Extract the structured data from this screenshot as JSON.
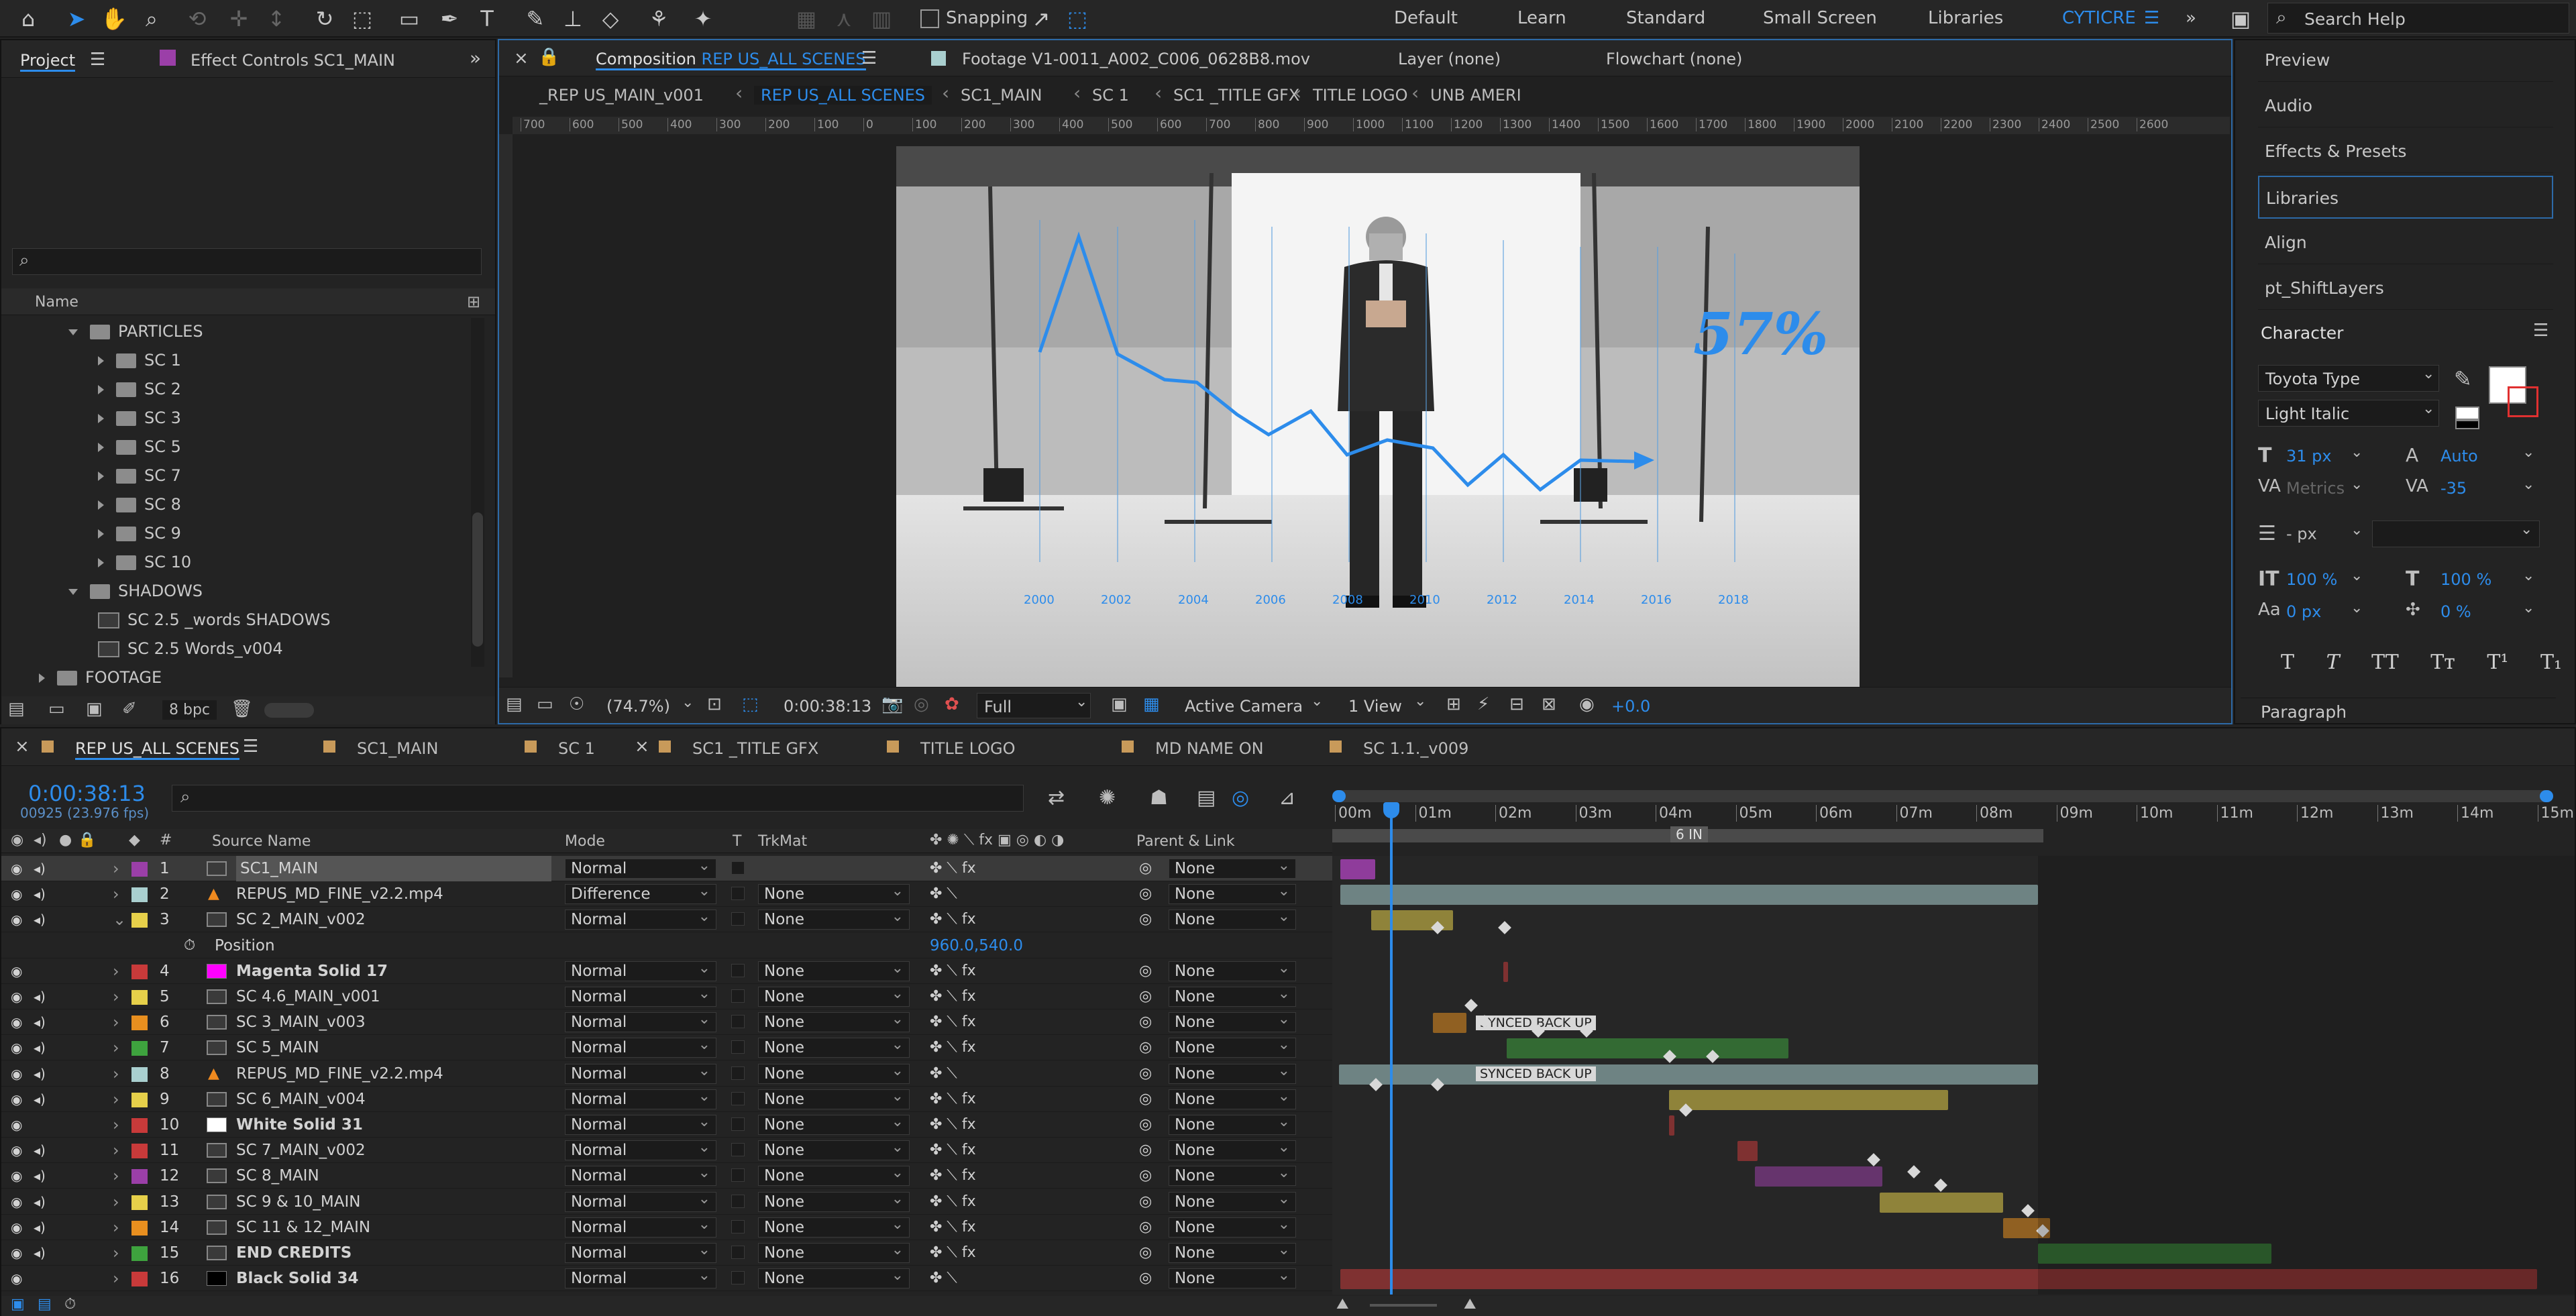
{
  "toolbar": {
    "snapping_label": "Snapping",
    "workspaces": [
      "Default",
      "Learn",
      "Standard",
      "Small Screen",
      "Libraries",
      "CYTICRE"
    ],
    "active_workspace": "CYTICRE",
    "search_placeholder": "Search Help"
  },
  "project_panel": {
    "tab_project": "Project",
    "tab_effect_controls": "Effect Controls SC1_MAIN",
    "column_name": "Name",
    "items": [
      {
        "label": "PARTICLES",
        "kind": "folder-open"
      },
      {
        "label": "SC 1",
        "kind": "folder"
      },
      {
        "label": "SC 2",
        "kind": "folder"
      },
      {
        "label": "SC 3",
        "kind": "folder"
      },
      {
        "label": "SC 5",
        "kind": "folder"
      },
      {
        "label": "SC 7",
        "kind": "folder"
      },
      {
        "label": "SC 8",
        "kind": "folder"
      },
      {
        "label": "SC 9",
        "kind": "folder"
      },
      {
        "label": "SC 10",
        "kind": "folder"
      },
      {
        "label": "SHADOWS",
        "kind": "folder-open"
      },
      {
        "label": "SC 2.5 _words SHADOWS",
        "kind": "comp"
      },
      {
        "label": "SC 2.5 Words_v004",
        "kind": "comp"
      },
      {
        "label": "FOOTAGE",
        "kind": "folder"
      }
    ],
    "bpc": "8 bpc"
  },
  "viewer": {
    "tab_composition": "Composition",
    "composition_name": "REP US_ALL SCENES",
    "tab_footage": "Footage V1-0011_A002_C006_0628B8.mov",
    "tab_layer": "Layer (none)",
    "tab_flowchart": "Flowchart (none)",
    "breadcrumbs": [
      "_REP US_MAIN_v001",
      "REP US_ALL SCENES",
      "SC1_MAIN",
      "SC 1",
      "SC1 _TITLE GFX",
      "TITLE LOGO",
      "UNB AMERI"
    ],
    "ruler_ticks": [
      "700",
      "600",
      "500",
      "400",
      "300",
      "200",
      "100",
      "0",
      "100",
      "200",
      "300",
      "400",
      "500",
      "600",
      "700",
      "800",
      "900",
      "1000",
      "1100",
      "1200",
      "1300",
      "1400",
      "1500",
      "1600",
      "1700",
      "1800",
      "1900",
      "2000",
      "2100",
      "2200",
      "2300",
      "2400",
      "2500",
      "2600"
    ],
    "zoom": "(74.7%)",
    "timecode": "0:00:38:13",
    "resolution": "Full",
    "camera": "Active Camera",
    "view_count": "1 View",
    "exposure": "+0.0",
    "overlay_percent": "57%",
    "overlay_years": [
      "2000",
      "2002",
      "2004",
      "2006",
      "2008",
      "2010",
      "2012",
      "2014",
      "2016",
      "2018"
    ]
  },
  "right_panel": {
    "items": [
      "Preview",
      "Audio",
      "Effects & Presets",
      "Libraries",
      "Align",
      "pt_ShiftLayers"
    ],
    "character": {
      "title": "Character",
      "font": "Toyota Type",
      "style": "Light Italic",
      "size": "31 px",
      "leading": "Auto",
      "kerning": "Metrics",
      "tracking": "-35",
      "stroke": "- px",
      "vscale": "100 %",
      "hscale": "100 %",
      "baseline": "0 px",
      "tsume": "0 %",
      "paragraph": "Paragraph"
    }
  },
  "timeline": {
    "tabs": [
      "REP US_ALL SCENES",
      "SC1_MAIN",
      "SC 1",
      "SC1 _TITLE GFX",
      "TITLE LOGO",
      "MD NAME ON",
      "SC 1.1._v009"
    ],
    "timecode": "0:00:38:13",
    "frames": "00925 (23.976 fps)",
    "columns": {
      "source_name": "Source Name",
      "mode": "Mode",
      "t": "T",
      "trkmat": "TrkMat",
      "parent": "Parent & Link"
    },
    "time_ticks": [
      "00m",
      "01m",
      "02m",
      "03m",
      "04m",
      "05m",
      "06m",
      "07m",
      "08m",
      "09m",
      "10m",
      "11m",
      "12m",
      "13m",
      "14m",
      "15m"
    ],
    "marker_label": "6 IN",
    "position_label": "Position",
    "position_value": "960.0,540.0",
    "layers": [
      {
        "num": "1",
        "name": "SC1_MAIN",
        "mode": "Normal",
        "trkmat": "",
        "parent": "None",
        "color": "#9b3fa8",
        "type": "comp"
      },
      {
        "num": "2",
        "name": "REPUS_MD_FINE_v2.2.mp4",
        "mode": "Difference",
        "trkmat": "None",
        "parent": "None",
        "color": "#a9cfcf",
        "type": "vlc"
      },
      {
        "num": "3",
        "name": "SC 2_MAIN_v002",
        "mode": "Normal",
        "trkmat": "None",
        "parent": "None",
        "color": "#e6d04a",
        "type": "comp"
      },
      {
        "num": "4",
        "name": "Magenta Solid 17",
        "mode": "Normal",
        "trkmat": "None",
        "parent": "None",
        "color": "#c83a3a",
        "type": "solid",
        "swatch": "#ff00ff"
      },
      {
        "num": "5",
        "name": "SC 4.6_MAIN_v001",
        "mode": "Normal",
        "trkmat": "None",
        "parent": "None",
        "color": "#e6d04a",
        "type": "comp"
      },
      {
        "num": "6",
        "name": "SC 3_MAIN_v003",
        "mode": "Normal",
        "trkmat": "None",
        "parent": "None",
        "color": "#e88f1f",
        "type": "comp"
      },
      {
        "num": "7",
        "name": "SC 5_MAIN",
        "mode": "Normal",
        "trkmat": "None",
        "parent": "None",
        "color": "#3ea33e",
        "type": "comp"
      },
      {
        "num": "8",
        "name": "REPUS_MD_FINE_v2.2.mp4",
        "mode": "Normal",
        "trkmat": "None",
        "parent": "None",
        "color": "#a9cfcf",
        "type": "vlc"
      },
      {
        "num": "9",
        "name": "SC 6_MAIN_v004",
        "mode": "Normal",
        "trkmat": "None",
        "parent": "None",
        "color": "#e6d04a",
        "type": "comp"
      },
      {
        "num": "10",
        "name": "White Solid 31",
        "mode": "Normal",
        "trkmat": "None",
        "parent": "None",
        "color": "#c83a3a",
        "type": "solid",
        "swatch": "#ffffff"
      },
      {
        "num": "11",
        "name": "SC 7_MAIN_v002",
        "mode": "Normal",
        "trkmat": "None",
        "parent": "None",
        "color": "#c83a3a",
        "type": "comp"
      },
      {
        "num": "12",
        "name": "SC 8_MAIN",
        "mode": "Normal",
        "trkmat": "None",
        "parent": "None",
        "color": "#9b3fa8",
        "type": "comp"
      },
      {
        "num": "13",
        "name": "SC 9 & 10_MAIN",
        "mode": "Normal",
        "trkmat": "None",
        "parent": "None",
        "color": "#e6d04a",
        "type": "comp"
      },
      {
        "num": "14",
        "name": "SC 11 & 12_MAIN",
        "mode": "Normal",
        "trkmat": "None",
        "parent": "None",
        "color": "#e88f1f",
        "type": "comp"
      },
      {
        "num": "15",
        "name": "END CREDITS",
        "mode": "Normal",
        "trkmat": "None",
        "parent": "None",
        "color": "#3ea33e",
        "type": "comp"
      },
      {
        "num": "16",
        "name": "Black Solid 34",
        "mode": "Normal",
        "trkmat": "None",
        "parent": "None",
        "color": "#c83a3a",
        "type": "solid",
        "swatch": "#000000"
      }
    ],
    "synced_label": "SYNCED BACK UP"
  },
  "colors": {
    "accent": "#2d8ceb",
    "panel": "#232323",
    "header": "#262626"
  }
}
